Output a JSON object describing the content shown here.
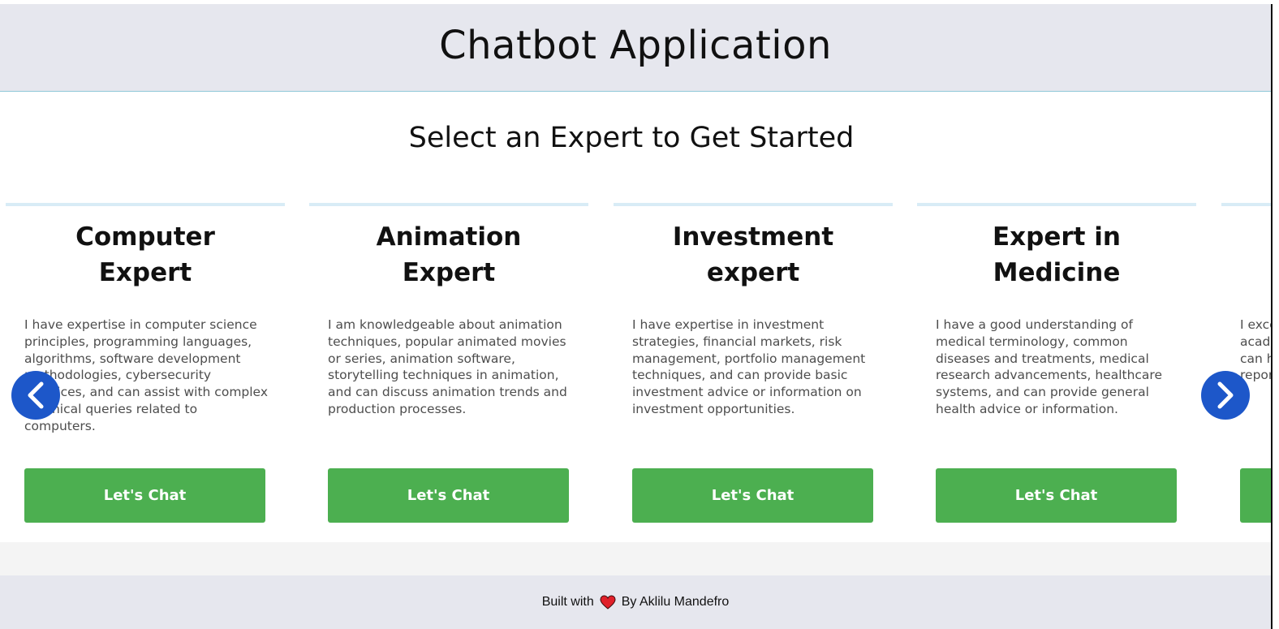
{
  "header": {
    "title": "Chatbot Application"
  },
  "main": {
    "subtitle": "Select an Expert to Get Started",
    "cards": [
      {
        "title_line1": "Computer",
        "title_line2": "Expert",
        "description": "I have expertise in computer science principles, programming languages, algorithms, software development methodologies, cybersecurity practices, and can assist with complex technical queries related to computers.",
        "button": "Let's Chat"
      },
      {
        "title_line1": "Animation",
        "title_line2": "Expert",
        "description": "I am knowledgeable about animation techniques, popular animated movies or series, animation software, storytelling techniques in animation, and can discuss animation trends and production processes.",
        "button": "Let's Chat"
      },
      {
        "title_line1": "Investment",
        "title_line2": "expert",
        "description": "I have expertise in investment strategies, financial markets, risk management, portfolio management techniques, and can provide basic investment advice or information on investment opportunities.",
        "button": "Let's Chat"
      },
      {
        "title_line1": "Expert in",
        "title_line2": "Medicine",
        "description": "I have a good understanding of medical terminology, common diseases and treatments, medical research advancements, healthcare systems, and can provide general health advice or information.",
        "button": "Let's Chat"
      },
      {
        "title_line1": "",
        "title_line2": "",
        "description": "I excel in statistical analysis, academic writing, considerations, and can help in research design and report writing.",
        "button": ""
      }
    ],
    "nav": {
      "prev_icon": "chevron-left-icon",
      "next_icon": "chevron-right-icon"
    }
  },
  "footer": {
    "prefix": "Built with",
    "heart_icon": "heart-icon",
    "suffix": "By Aklilu Mandefro"
  },
  "colors": {
    "header_bg": "#e6e7ee",
    "button_green": "#4caf50",
    "nav_blue": "#1d57c9",
    "heart_red": "#e0202a"
  }
}
